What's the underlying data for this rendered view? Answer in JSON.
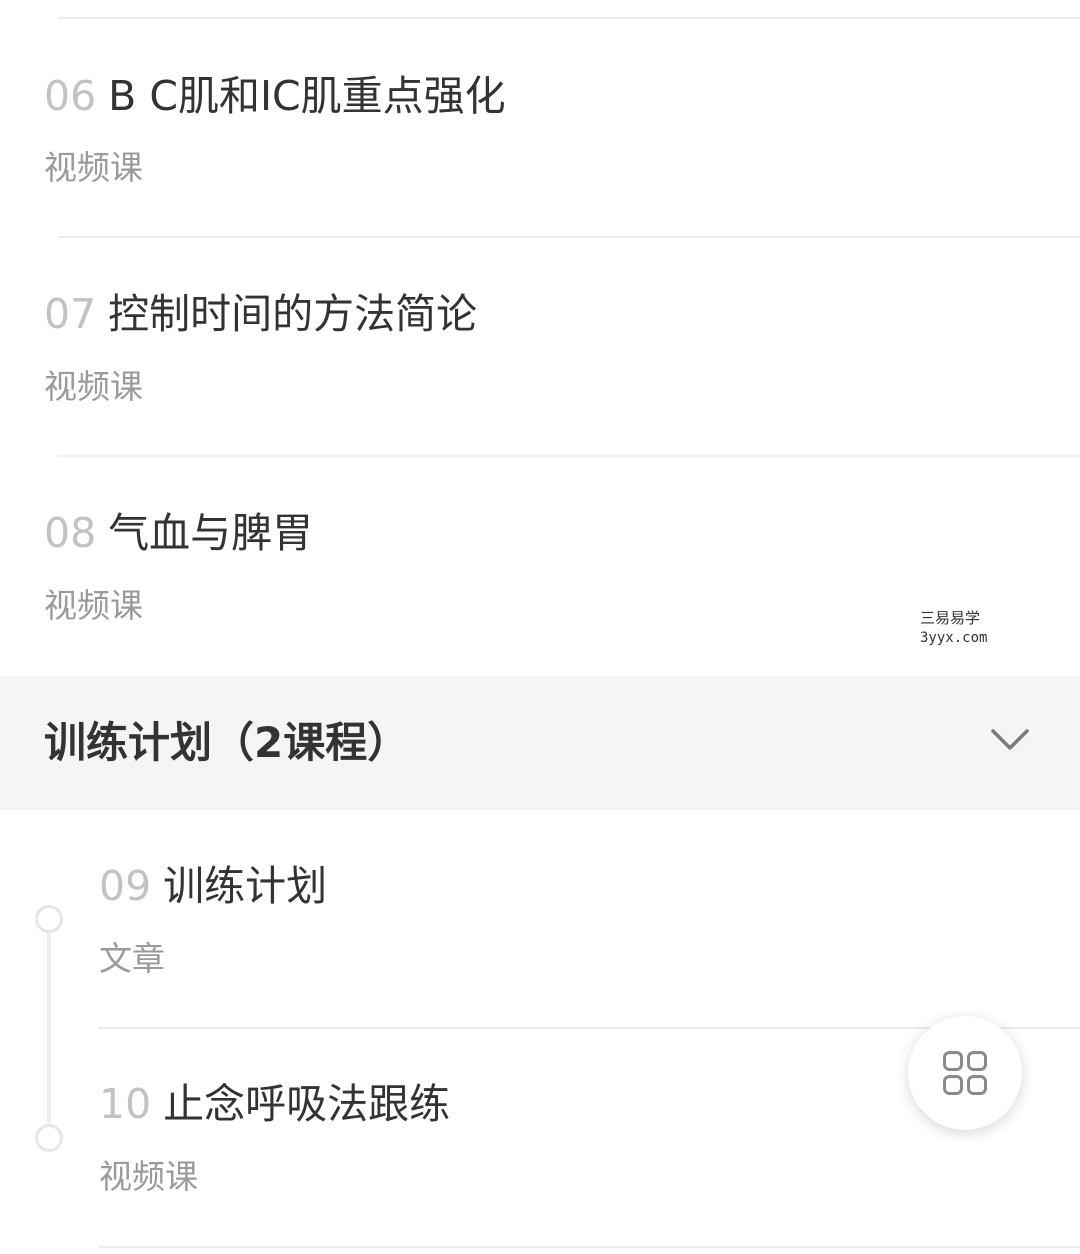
{
  "lessons": [
    {
      "num": "06",
      "title": "B C肌和IC肌重点强化",
      "type": "视频课"
    },
    {
      "num": "07",
      "title": "控制时间的方法简论",
      "type": "视频课"
    },
    {
      "num": "08",
      "title": "气血与脾胃",
      "type": "视频课"
    }
  ],
  "section": {
    "title": "训练计划（2课程）"
  },
  "section_lessons": [
    {
      "num": "09",
      "title": "训练计划",
      "type": "文章"
    },
    {
      "num": "10",
      "title": "止念呼吸法跟练",
      "type": "视频课"
    }
  ],
  "watermark": {
    "line1": "三易易学",
    "line2": "3yyx.com"
  },
  "icons": {
    "collapse": "chevron-down-icon",
    "fab": "grid-icon"
  },
  "colors": {
    "title": "#333333",
    "number": "#c2c2c2",
    "type": "#9a9a9a",
    "section_bg": "#f5f5f5",
    "divider": "#ececec"
  }
}
